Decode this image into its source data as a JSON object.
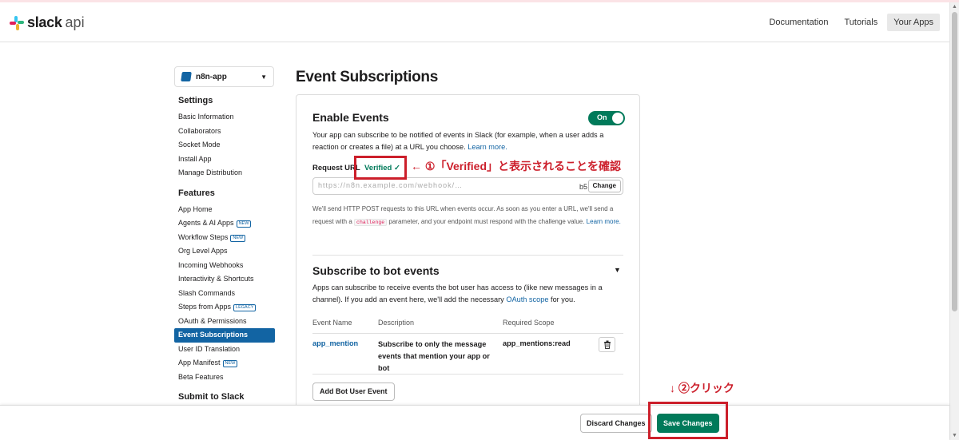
{
  "header": {
    "brand": "slack",
    "brand_suffix": "api",
    "nav": [
      "Documentation",
      "Tutorials",
      "Your Apps"
    ],
    "active_nav": "Your Apps"
  },
  "app_selector": {
    "name": "n8n-app"
  },
  "sidebar": {
    "settings_title": "Settings",
    "settings": [
      "Basic Information",
      "Collaborators",
      "Socket Mode",
      "Install App",
      "Manage Distribution"
    ],
    "features_title": "Features",
    "features": [
      {
        "label": "App Home",
        "badge": ""
      },
      {
        "label": "Agents & AI Apps",
        "badge": "NEW"
      },
      {
        "label": "Workflow Steps",
        "badge": "NEW"
      },
      {
        "label": "Org Level Apps",
        "badge": ""
      },
      {
        "label": "Incoming Webhooks",
        "badge": ""
      },
      {
        "label": "Interactivity & Shortcuts",
        "badge": ""
      },
      {
        "label": "Slash Commands",
        "badge": ""
      },
      {
        "label": "Steps from Apps",
        "badge": "LEGACY"
      },
      {
        "label": "OAuth & Permissions",
        "badge": ""
      },
      {
        "label": "Event Subscriptions",
        "badge": "",
        "active": true
      },
      {
        "label": "User ID Translation",
        "badge": ""
      },
      {
        "label": "App Manifest",
        "badge": "NEW"
      },
      {
        "label": "Beta Features",
        "badge": ""
      }
    ],
    "submit_title": "Submit to Slack"
  },
  "main": {
    "page_title": "Event Subscriptions",
    "enable": {
      "title": "Enable Events",
      "toggle_label": "On",
      "desc_prefix": "Your app can subscribe to be notified of events in Slack (for example, when a user adds a reaction or creates a file) at a URL you choose.",
      "learn_more": "Learn more.",
      "request_url_label": "Request URL",
      "verified": "Verified ✓",
      "url_masked": "https://n8n.example.com/webhook/…",
      "url_end": "b5",
      "change_button": "Change",
      "note_a": "We'll send HTTP POST requests to this URL when events occur. As soon as you enter a URL, we'll send a request with a",
      "note_code": "challenge",
      "note_b": "parameter, and your endpoint must respond with the challenge value.",
      "note_link": "Learn more."
    },
    "bot_events": {
      "title": "Subscribe to bot events",
      "desc_prefix": "Apps can subscribe to receive events the bot user has access to (like new messages in a channel). If you add an event here, we'll add the necessary",
      "oauth_link": "OAuth scope",
      "desc_suffix": "for you.",
      "columns": [
        "Event Name",
        "Description",
        "Required Scope"
      ],
      "rows": [
        {
          "name": "app_mention",
          "description": "Subscribe to only the message events that mention your app or bot",
          "scope": "app_mentions:read"
        }
      ],
      "add_button": "Add Bot User Event"
    }
  },
  "footer": {
    "discard": "Discard Changes",
    "save": "Save Changes"
  },
  "annotations": {
    "step1": "← ①「Verified」と表示されることを確認",
    "step2": "↓ ②クリック"
  },
  "colors": {
    "green": "#007a5a",
    "blue": "#1264a3",
    "annotation_red": "#cc1f2b"
  }
}
